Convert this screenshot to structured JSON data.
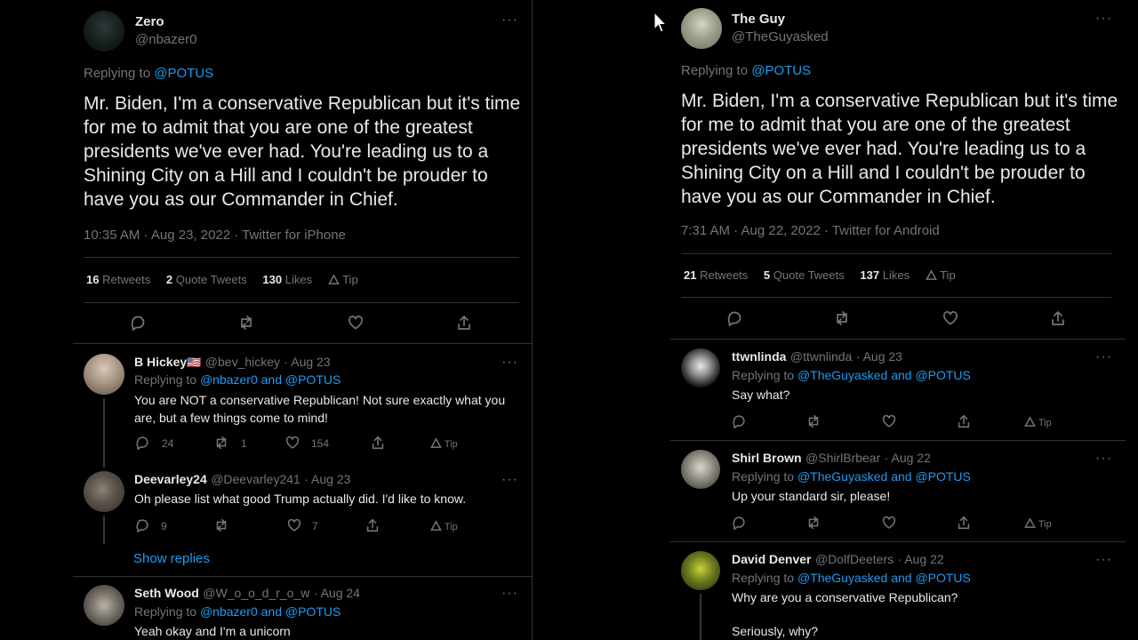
{
  "left": {
    "author": {
      "name": "Zero",
      "handle": "@nbazer0"
    },
    "replying_prefix": "Replying to ",
    "replying_to": "@POTUS",
    "text": "Mr. Biden, I'm a conservative Republican but it's time for me to admit that you are one of the greatest presidents we've ever had. You're leading us to a Shining City on a Hill and I couldn't be prouder to have you as our Commander in Chief.",
    "meta": "10:35 AM · Aug 23, 2022 · Twitter for iPhone",
    "retweets": "16",
    "retweets_label": "Retweets",
    "quotes": "2",
    "quotes_label": "Quote Tweets",
    "likes": "130",
    "likes_label": "Likes",
    "tip_label": "Tip",
    "replies": [
      {
        "name": "B Hickey",
        "flag": "🇺🇸",
        "handle": "@bev_hickey",
        "date": "· Aug 23",
        "replying_prefix": "Replying to ",
        "replying_to": "@nbazer0 and @POTUS",
        "text": "You are NOT a conservative Republican!  Not sure exactly what you are, but a few things come to mind!",
        "reply_count": "24",
        "retweet_count": "1",
        "like_count": "154",
        "tip": "Tip"
      },
      {
        "name": "Deevarley24",
        "handle": "@Deevarley241",
        "date": "· Aug 23",
        "text": "Oh please list what good Trump actually did. I'd like to know.",
        "reply_count": "9",
        "retweet_count": "",
        "like_count": "7",
        "tip": "Tip"
      },
      {
        "name": "Seth Wood",
        "handle": "@W_o_o_d_r_o_w",
        "date": "· Aug 24",
        "replying_prefix": "Replying to ",
        "replying_to": "@nbazer0 and @POTUS",
        "text": "Yeah okay and I'm a unicorn"
      }
    ],
    "show_replies": "Show replies",
    "more": "···"
  },
  "right": {
    "author": {
      "name": "The Guy",
      "handle": "@TheGuyasked"
    },
    "replying_prefix": "Replying to ",
    "replying_to": "@POTUS",
    "text": "Mr. Biden, I'm a conservative Republican but it's time for me to admit that you are one of the greatest presidents we've ever had. You're leading us to a Shining City on a Hill and I couldn't be prouder to have you as our Commander in Chief.",
    "meta": "7:31 AM · Aug 22, 2022 · Twitter for Android",
    "retweets": "21",
    "retweets_label": "Retweets",
    "quotes": "5",
    "quotes_label": "Quote Tweets",
    "likes": "137",
    "likes_label": "Likes",
    "tip_label": "Tip",
    "replies": [
      {
        "name": "ttwnlinda",
        "handle": "@ttwnlinda",
        "date": "· Aug 23",
        "replying_prefix": "Replying to ",
        "replying_to": "@TheGuyasked and @POTUS",
        "text": "Say what?",
        "tip": "Tip"
      },
      {
        "name": "Shirl Brown",
        "handle": "@ShirlBrbear",
        "date": "· Aug 22",
        "replying_prefix": "Replying to ",
        "replying_to": "@TheGuyasked and @POTUS",
        "text": "Up your standard sir, please!",
        "tip": "Tip"
      },
      {
        "name": "David Denver",
        "handle": "@DolfDeeters",
        "date": "· Aug 22",
        "replying_prefix": "Replying to ",
        "replying_to": "@TheGuyasked and @POTUS",
        "text": "Why are you a conservative Republican?",
        "text2": "Seriously, why?"
      }
    ],
    "more": "···"
  },
  "colors": {
    "background": "#000000",
    "text": "#e7e9ea",
    "muted": "#71767b",
    "link": "#1d9bf0",
    "divider": "#2f3336"
  }
}
